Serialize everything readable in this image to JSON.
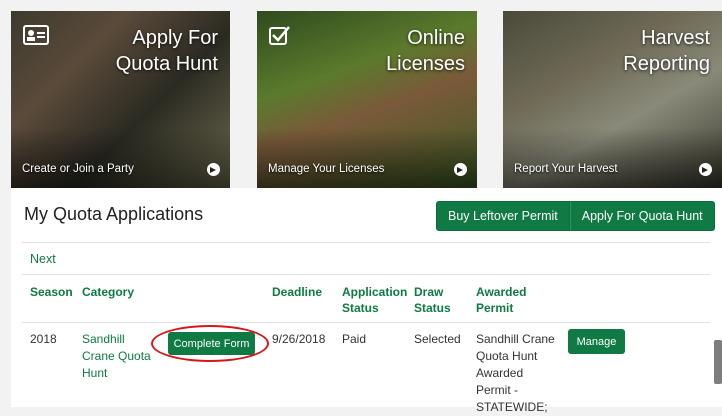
{
  "tiles": [
    {
      "title_line1": "Apply For",
      "title_line2": "Quota Hunt",
      "subtitle": "Create or Join a Party",
      "icon": "id-card-icon"
    },
    {
      "title_line1": "Online",
      "title_line2": "Licenses",
      "subtitle": "Manage Your Licenses",
      "icon": "checkbox-icon"
    },
    {
      "title_line1": "Harvest",
      "title_line2": "Reporting",
      "subtitle": "Report Your Harvest",
      "icon": "none"
    }
  ],
  "panel": {
    "title": "My Quota Applications",
    "buy_leftover_label": "Buy Leftover Permit",
    "apply_quota_label": "Apply For Quota Hunt",
    "next_label": "Next"
  },
  "table": {
    "headers": {
      "season": "Season",
      "category": "Category",
      "deadline": "Deadline",
      "app_status_1": "Application",
      "app_status_2": "Status",
      "draw_status_1": "Draw",
      "draw_status_2": "Status",
      "awarded_1": "Awarded",
      "awarded_2": "Permit"
    },
    "row": {
      "season": "2018",
      "category_1": "Sandhill",
      "category_2": "Crane Quota",
      "category_3": "Hunt",
      "complete_label": "Complete Form",
      "deadline": "9/26/2018",
      "app_status": "Paid",
      "draw_status": "Selected",
      "awarded_1": "Sandhill Crane",
      "awarded_2": "Quota Hunt",
      "awarded_3": "Awarded",
      "awarded_4": "Permit -",
      "awarded_5": "STATEWIDE;",
      "manage_label": "Manage"
    }
  },
  "colors": {
    "accent": "#0f7a43",
    "highlight": "#d8151b"
  }
}
